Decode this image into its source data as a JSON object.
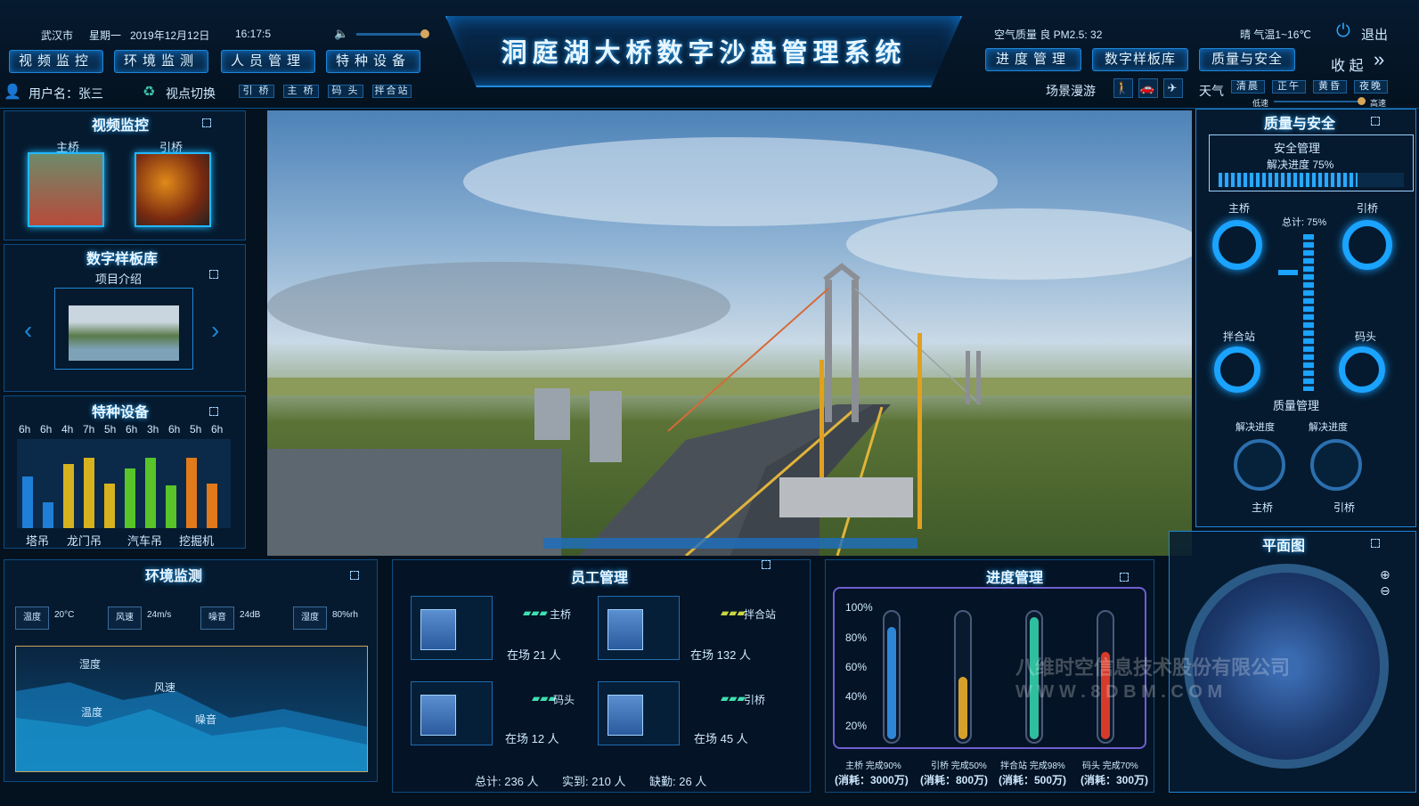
{
  "header": {
    "city": "武汉市",
    "weekday": "星期一",
    "date": "2019年12月12日",
    "time": "16:17:5",
    "title": "洞庭湖大桥数字沙盘管理系统",
    "air_quality": "空气质量 良 PM2.5: 32",
    "weather": "晴  气温1~16℃",
    "logout": "退出",
    "collapse": "收 起",
    "nav_left": [
      "视频监控",
      "环境监测",
      "人员管理",
      "特种设备"
    ],
    "nav_right": [
      "进度管理",
      "数字样板库",
      "质量与安全"
    ],
    "username": "用户名：张三",
    "viewpoint": "视点切换",
    "view_options": [
      "引 桥",
      "主 桥",
      "码 头",
      "拌合站"
    ],
    "scene_roam": "场景漫游",
    "weather_label": "天气",
    "weather_options": [
      "清晨",
      "正午",
      "黄昏",
      "夜晚"
    ],
    "speed_low": "低速",
    "speed_high": "高速"
  },
  "video": {
    "title": "视频监控",
    "cams": [
      "主桥",
      "引桥"
    ]
  },
  "library": {
    "title": "数字样板库",
    "item": "项目介绍"
  },
  "equipment": {
    "title": "特种设备",
    "hours": [
      "6h",
      "6h",
      "4h",
      "7h",
      "5h",
      "6h",
      "3h",
      "6h",
      "5h",
      "6h"
    ],
    "fill": [
      0.6,
      0.3,
      0.75,
      0.82,
      0.52,
      0.7,
      0.82,
      0.5,
      0.82,
      0.52
    ],
    "colors": [
      "#1f7fd6",
      "#1f7fd6",
      "#d6b21f",
      "#d6b21f",
      "#d6b21f",
      "#58c42a",
      "#58c42a",
      "#58c42a",
      "#e07a1a",
      "#e07a1a"
    ],
    "labels": [
      "塔吊",
      "龙门吊",
      "汽车吊",
      "挖掘机"
    ]
  },
  "env": {
    "title": "环境监测",
    "chips": [
      {
        "name": "温度",
        "value": "20°C"
      },
      {
        "name": "风速",
        "value": "24m/s"
      },
      {
        "name": "噪音",
        "value": "24dB"
      },
      {
        "name": "湿度",
        "value": "80%rh"
      }
    ],
    "chart_labels": [
      "湿度",
      "风速",
      "温度",
      "噪音"
    ]
  },
  "staff": {
    "title": "员工管理",
    "cards": [
      {
        "site": "主桥",
        "count": "在场  21  人"
      },
      {
        "site": "拌合站",
        "count": "在场  132  人"
      },
      {
        "site": "码头",
        "count": "在场  12  人"
      },
      {
        "site": "引桥",
        "count": "在场  45  人"
      }
    ],
    "summary": [
      "总计: 236  人",
      "实到: 210  人",
      "缺勤: 26  人"
    ]
  },
  "progress": {
    "title": "进度管理",
    "ticks": [
      "100%",
      "80%",
      "60%",
      "40%",
      "20%"
    ],
    "fills": [
      0.9,
      0.5,
      0.98,
      0.7
    ],
    "colors": [
      "#2f86d6",
      "#d6a12a",
      "#2fbf9f",
      "#d63a2a"
    ],
    "captions": [
      "主桥 完成90%",
      "引桥 完成50%",
      "拌合站 完成98%",
      "码头 完成70%"
    ],
    "costs": [
      "(消耗：3000万)",
      "(消耗：800万)",
      "(消耗：500万)",
      "(消耗：300万)"
    ]
  },
  "quality": {
    "title": "质量与安全",
    "safety_title": "安全管理",
    "resolve": "解决进度   75%",
    "total": "总计: 75%",
    "rings": [
      "主桥",
      "引桥",
      "拌合站",
      "码头"
    ],
    "qm_title": "质量管理",
    "gauge_label": "解决进度",
    "gauge_sites": [
      "主桥",
      "引桥"
    ]
  },
  "plan": {
    "title": "平面图"
  },
  "watermark": [
    "八维时空信息技术股份有限公司",
    "W W W . 8 D B M . C O M"
  ]
}
